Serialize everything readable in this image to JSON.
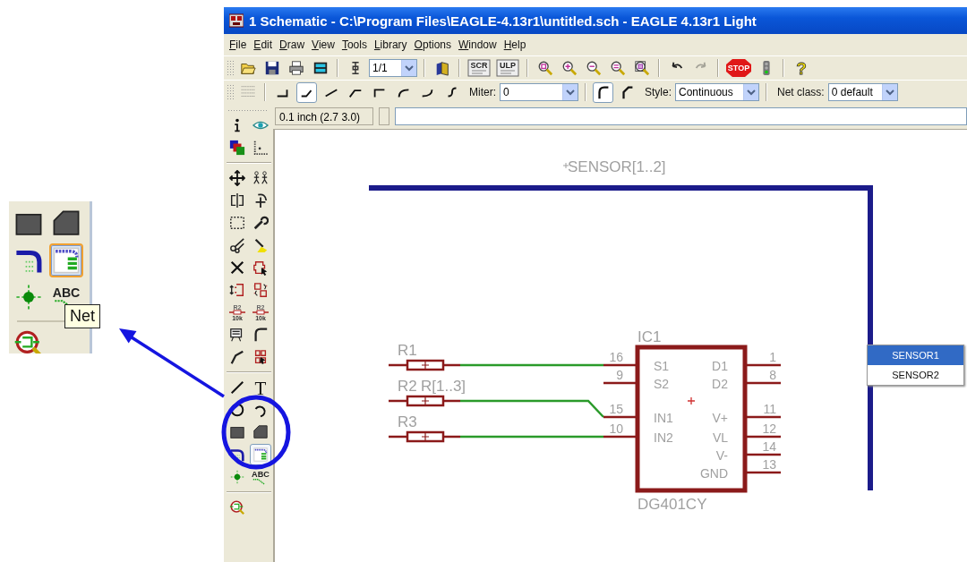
{
  "inset": {
    "tools": [
      {
        "kind": "rect",
        "selected": false
      },
      {
        "kind": "polygon",
        "selected": false
      },
      {
        "kind": "bus",
        "selected": false
      },
      {
        "kind": "net",
        "selected": true
      },
      {
        "kind": "junction",
        "selected": false
      },
      {
        "kind": "label",
        "text": "ABC",
        "selected": false
      },
      {
        "kind": "separator"
      },
      {
        "kind": "erc",
        "selected": false
      }
    ],
    "tooltip": "Net"
  },
  "window": {
    "title": "1 Schematic - C:\\Program Files\\EAGLE-4.13r1\\untitled.sch - EAGLE 4.13r1 Light"
  },
  "menu": [
    "File",
    "Edit",
    "Draw",
    "View",
    "Tools",
    "Library",
    "Options",
    "Window",
    "Help"
  ],
  "toolbar": [
    {
      "kind": "open"
    },
    {
      "kind": "save"
    },
    {
      "kind": "print"
    },
    {
      "kind": "cam"
    },
    {
      "kind": "separator"
    },
    {
      "kind": "use"
    },
    {
      "kind": "combo",
      "value": "1/1"
    },
    {
      "kind": "separator"
    },
    {
      "kind": "library"
    },
    {
      "kind": "separator"
    },
    {
      "kind": "script",
      "text": "SCR"
    },
    {
      "kind": "ulp",
      "text": "ULP"
    },
    {
      "kind": "separator"
    },
    {
      "kind": "zoom-fit"
    },
    {
      "kind": "zoom-in"
    },
    {
      "kind": "zoom-out"
    },
    {
      "kind": "zoom-redraw"
    },
    {
      "kind": "zoom-select"
    },
    {
      "kind": "separator"
    },
    {
      "kind": "undo",
      "disabled": false
    },
    {
      "kind": "redo",
      "disabled": true
    },
    {
      "kind": "separator"
    },
    {
      "kind": "stop",
      "text": "STOP"
    },
    {
      "kind": "go"
    },
    {
      "kind": "separator"
    },
    {
      "kind": "help",
      "text": "?"
    }
  ],
  "net_toolbar": {
    "bends": [
      {
        "kind": "b1",
        "selected": false
      },
      {
        "kind": "b2",
        "selected": true
      },
      {
        "kind": "b3",
        "selected": false
      },
      {
        "kind": "b4",
        "selected": false
      },
      {
        "kind": "b5",
        "selected": false
      },
      {
        "kind": "b6",
        "selected": false
      },
      {
        "kind": "b7",
        "selected": false
      },
      {
        "kind": "b8",
        "selected": false
      }
    ],
    "miter_label": "Miter:",
    "miter": "0",
    "miter_styles": [
      {
        "kind": "round",
        "selected": true
      },
      {
        "kind": "sharp",
        "selected": false
      }
    ],
    "style_label": "Style:",
    "style": "Continuous",
    "net_class_label": "Net class:",
    "net_class": "0 default"
  },
  "coordinates": "0.1 inch (2.7 3.0)",
  "tools": [
    {
      "kind": "info",
      "selected": false
    },
    {
      "kind": "show",
      "selected": false
    },
    {
      "kind": "layers",
      "selected": false
    },
    {
      "kind": "grid",
      "selected": false
    },
    {
      "kind": "separator"
    },
    {
      "kind": "move",
      "selected": false
    },
    {
      "kind": "copy",
      "selected": false
    },
    {
      "kind": "mirror",
      "selected": false
    },
    {
      "kind": "rotate",
      "selected": false
    },
    {
      "kind": "group",
      "selected": false
    },
    {
      "kind": "change",
      "selected": false
    },
    {
      "kind": "cut",
      "selected": false
    },
    {
      "kind": "paste",
      "selected": false
    },
    {
      "kind": "delete",
      "selected": false
    },
    {
      "kind": "add",
      "selected": false
    },
    {
      "kind": "pinswap",
      "selected": false
    },
    {
      "kind": "gateswap",
      "selected": false
    },
    {
      "kind": "name",
      "text": "R2",
      "subtext": "10k",
      "selected": false
    },
    {
      "kind": "value",
      "text": "R2",
      "subtext": "10k",
      "selected": false
    },
    {
      "kind": "smash",
      "selected": false
    },
    {
      "kind": "miter",
      "selected": false
    },
    {
      "kind": "split",
      "selected": false
    },
    {
      "kind": "invoke",
      "selected": false
    },
    {
      "kind": "separator"
    },
    {
      "kind": "line",
      "selected": false
    },
    {
      "kind": "text",
      "text": "T",
      "selected": false
    },
    {
      "kind": "circle",
      "selected": false
    },
    {
      "kind": "arc",
      "selected": false
    },
    {
      "kind": "rect",
      "selected": false
    },
    {
      "kind": "polygon",
      "selected": false
    },
    {
      "kind": "bus",
      "selected": false
    },
    {
      "kind": "net",
      "selected": true
    },
    {
      "kind": "junction",
      "selected": false
    },
    {
      "kind": "label",
      "text": "ABC",
      "selected": false
    },
    {
      "kind": "separator"
    },
    {
      "kind": "erc",
      "selected": false
    }
  ],
  "schematic": {
    "bus_label": "SENSOR[1..2]",
    "resistors": [
      {
        "name": "R1"
      },
      {
        "name": "R2"
      },
      {
        "name": "R3"
      }
    ],
    "resistor_group_label": "R[1..3]",
    "ic": {
      "name": "IC1",
      "value": "DG401CY",
      "left_pins": [
        {
          "number": "16",
          "name": "S1"
        },
        {
          "number": "9",
          "name": "S2"
        },
        {
          "number": "15",
          "name": "IN1"
        },
        {
          "number": "10",
          "name": "IN2"
        }
      ],
      "right_pins": [
        {
          "number": "1",
          "name": "D1"
        },
        {
          "number": "8",
          "name": "D2"
        },
        {
          "number": "11",
          "name": "V+"
        },
        {
          "number": "12",
          "name": "VL"
        },
        {
          "number": "14",
          "name": "V-"
        },
        {
          "number": "13",
          "name": "GND"
        }
      ]
    },
    "popup": [
      {
        "label": "SENSOR1",
        "selected": true
      },
      {
        "label": "SENSOR2",
        "selected": false
      }
    ]
  }
}
